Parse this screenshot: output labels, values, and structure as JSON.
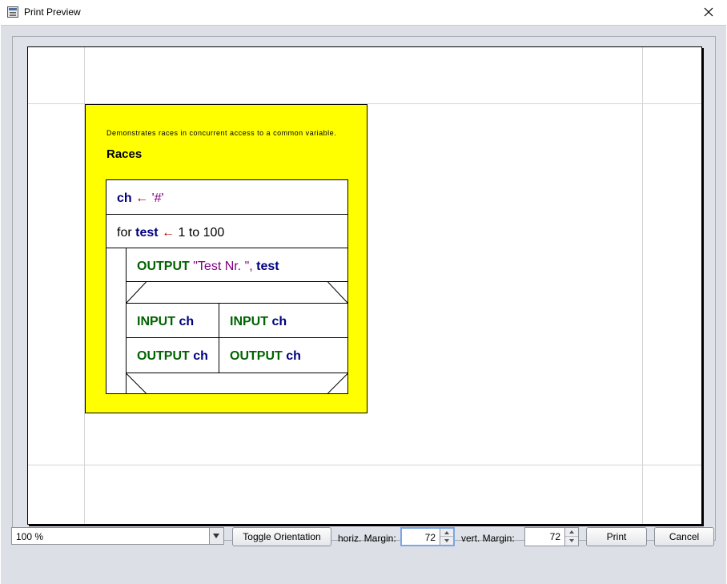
{
  "window": {
    "title": "Print Preview",
    "icon": "print-preview-icon",
    "close_icon": "close-icon"
  },
  "diagram": {
    "background_color": "#ffff00",
    "comment": "Demonstrates races in concurrent access to a common variable.",
    "title": "Races",
    "assign": {
      "var": "ch",
      "arrow": "←",
      "value": "'#'"
    },
    "loop": {
      "keyword": "for",
      "var": "test",
      "arrow": "←",
      "range": "1 to 100"
    },
    "output": {
      "keyword": "OUTPUT",
      "text": "\"Test Nr. \", ",
      "var": "test"
    },
    "parallel": {
      "left": {
        "input_kw": "INPUT",
        "input_var": "ch",
        "output_kw": "OUTPUT",
        "output_var": "ch"
      },
      "right": {
        "input_kw": "INPUT",
        "input_var": "ch",
        "output_kw": "OUTPUT",
        "output_var": "ch"
      }
    }
  },
  "bottom": {
    "zoom": "100 %",
    "toggle_orientation": "Toggle Orientation",
    "horiz_margin_label": "horiz. Margin:",
    "horiz_margin_value": "72",
    "vert_margin_label": "vert. Margin:",
    "vert_margin_value": "72",
    "print": "Print",
    "cancel": "Cancel"
  }
}
